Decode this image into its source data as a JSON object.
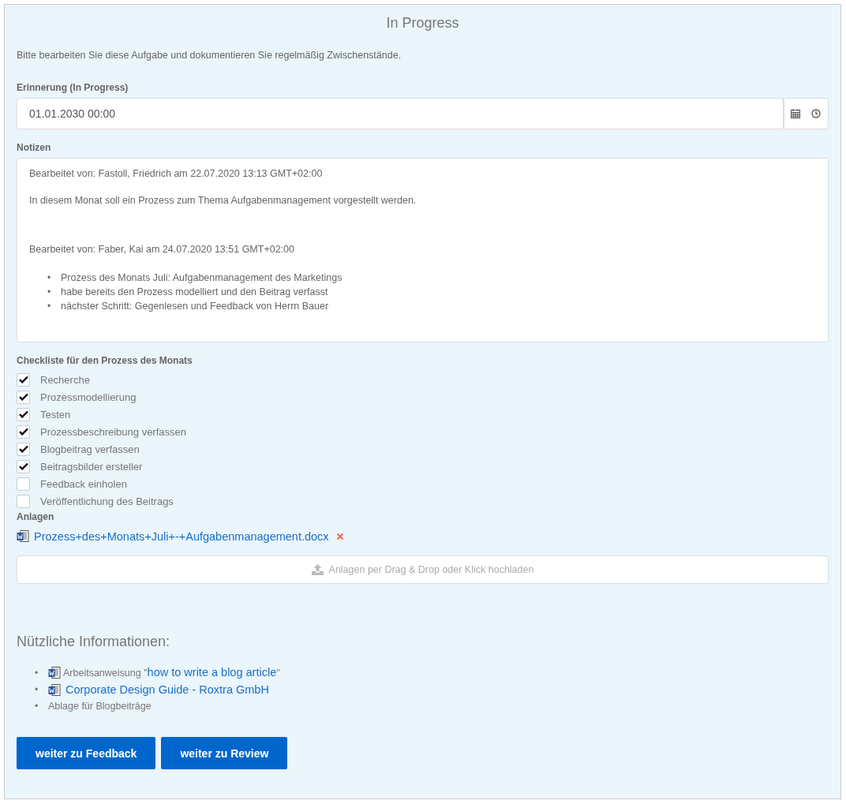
{
  "title": "In Progress",
  "instruction": "Bitte bearbeiten Sie diese Aufgabe und dokumentieren Sie regelmäßig Zwischenstände.",
  "reminder": {
    "label": "Erinnerung (In Progress)",
    "value": "01.01.2030 00:00"
  },
  "notes": {
    "label": "Notizen",
    "entries": [
      {
        "kind": "text",
        "text": "Bearbeitet von: Fastoll, Friedrich am 22.07.2020 13:13 GMT+02:00"
      },
      {
        "kind": "text",
        "text": "In diesem Monat soll ein Prozess zum Thema Aufgabenmanagement vorgestellt werden."
      },
      {
        "kind": "spacer"
      },
      {
        "kind": "text",
        "text": "Bearbeitet von: Faber, Kai am 24.07.2020 13:51 GMT+02:00"
      },
      {
        "kind": "list",
        "marker": "•",
        "items": [
          "Prozess des Monats Juli: Aufgabenmanagement des Marketings",
          "habe bereits den Prozess modelliert und den Beitrag verfasst",
          "nächster Schritt: Gegenlesen und Feedback von Herrn Bauer"
        ]
      }
    ]
  },
  "checklist": {
    "label": "Checkliste für den Prozess des Monats",
    "items": [
      {
        "label": "Recherche",
        "checked": true
      },
      {
        "label": "Prozessmodellierung",
        "checked": true
      },
      {
        "label": "Testen",
        "checked": true
      },
      {
        "label": "Prozessbeschreibung verfassen",
        "checked": true
      },
      {
        "label": "Blogbeitrag verfassen",
        "checked": true
      },
      {
        "label": "Beitragsbilder ersteller",
        "checked": true
      },
      {
        "label": "Feedback einholen",
        "checked": false
      },
      {
        "label": "Veröffentlichung des Beitrags",
        "checked": false
      }
    ]
  },
  "attachments": {
    "label": "Anlagen",
    "files": [
      {
        "name": "Prozess+des+Monats+Juli+-+Aufgabenmanagement.docx"
      }
    ],
    "upload": "Anlagen per Drag & Drop oder Klick hochladen"
  },
  "useful_info": {
    "heading": "Nützliche Informationen:",
    "marker": "•",
    "items": [
      {
        "kind": "doc",
        "prefix": "Arbeitsanweisung \"",
        "link": "how to write a blog article",
        "suffix": "\""
      },
      {
        "kind": "doc",
        "link": "Corporate Design Guide - Roxtra GmbH"
      },
      {
        "kind": "text",
        "text": "Ablage für Blogbeiträge"
      }
    ]
  },
  "buttons": [
    "weiter zu Feedback",
    "weiter zu Review"
  ]
}
